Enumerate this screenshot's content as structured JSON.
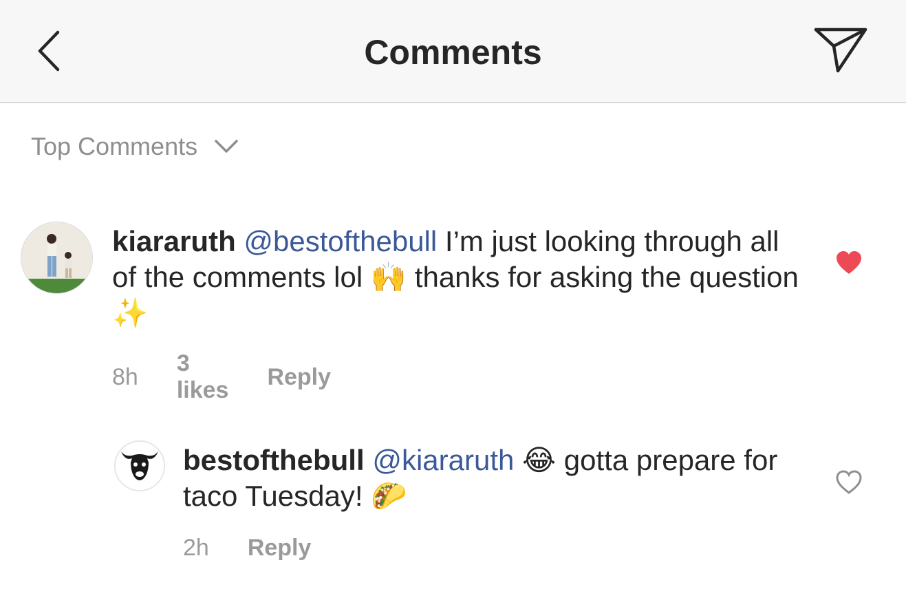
{
  "header": {
    "title": "Comments",
    "back_icon": "chevron-left-icon",
    "send_icon": "paper-plane-icon"
  },
  "sort": {
    "label": "Top Comments",
    "icon": "chevron-down-icon"
  },
  "comments": [
    {
      "username": "kiararuth",
      "mention": "@bestofthebull",
      "text_a": " I’m just looking through all of the comments lol ",
      "emoji_a": "🙌",
      "text_b": " thanks for asking the question ",
      "emoji_b": "✨",
      "time": "8h",
      "likes": "3 likes",
      "reply": "Reply",
      "liked": true,
      "heart_color": "#ed4956"
    },
    {
      "username": "bestofthebull",
      "mention": "@kiararuth",
      "text_a": " ",
      "emoji_a": "😂",
      "text_b": " gotta prepare for taco Tuesday! ",
      "emoji_b": "🌮",
      "time": "2h",
      "reply": "Reply",
      "liked": false,
      "heart_color": "#8e8e8e"
    }
  ],
  "colors": {
    "mention": "#3b5998",
    "meta": "#9a9a9a",
    "header_bg": "#f7f7f7"
  }
}
